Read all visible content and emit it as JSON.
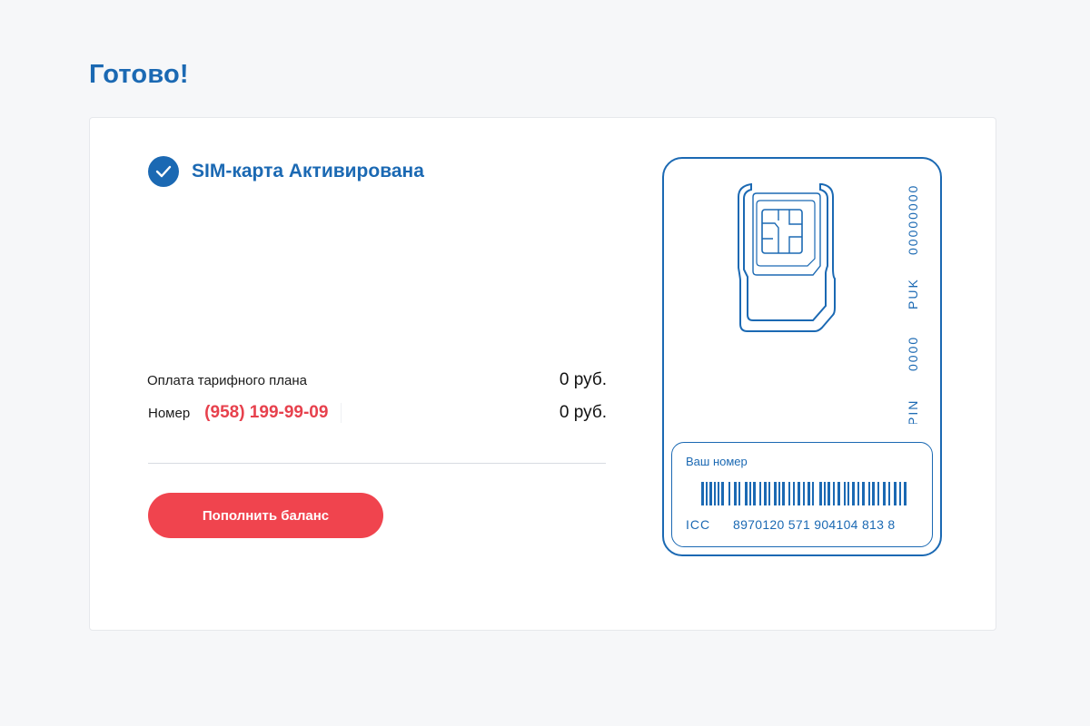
{
  "page": {
    "title": "Готово!"
  },
  "status": {
    "text": "SIM-карта Активирована",
    "icon": "check-circle-icon"
  },
  "summary": {
    "tariff_label": "Оплата тарифного плана",
    "tariff_value": "0 руб.",
    "number_label": "Номер",
    "phone": "(958) 199-99-09",
    "number_value": "0 руб."
  },
  "actions": {
    "topup_label": "Пополнить баланс"
  },
  "sim": {
    "puk_value": "00000000",
    "puk_label": "PUK",
    "pin_value": "0000",
    "pin_label": "PIN",
    "your_number_label": "Ваш номер",
    "icc_label": "ICC",
    "icc_value": "8970120 571 904104 813 8"
  },
  "colors": {
    "brand_blue": "#1b69b3",
    "accent_red": "#f0444e",
    "phone_red": "#e7414d",
    "background": "#f6f7f9"
  }
}
